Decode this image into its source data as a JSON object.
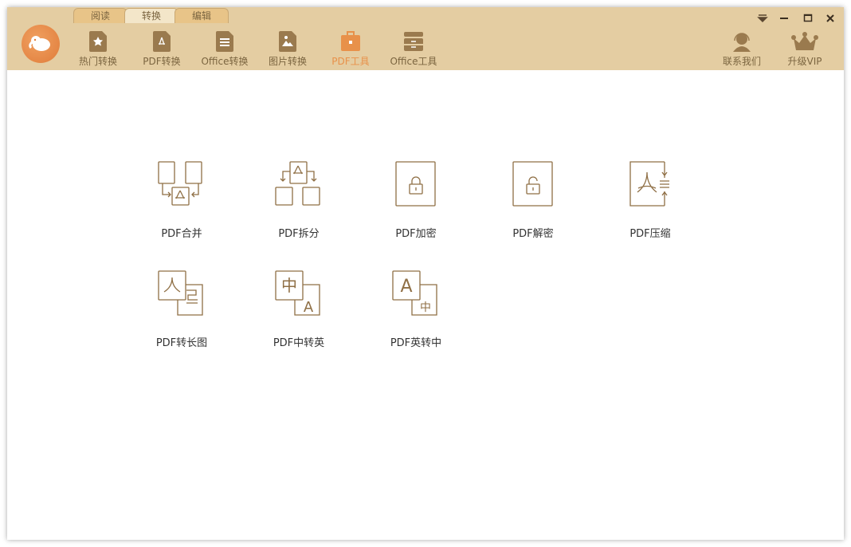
{
  "tabs": [
    {
      "label": "阅读"
    },
    {
      "label": "转换"
    },
    {
      "label": "编辑"
    }
  ],
  "active_tab": "转换",
  "nav": [
    {
      "label": "热门转换"
    },
    {
      "label": "PDF转换"
    },
    {
      "label": "Office转换"
    },
    {
      "label": "图片转换"
    },
    {
      "label": "PDF工具"
    },
    {
      "label": "Office工具"
    }
  ],
  "active_nav": "PDF工具",
  "right": {
    "contact": "联系我们",
    "vip": "升级VIP"
  },
  "tools": [
    {
      "label": "PDF合并"
    },
    {
      "label": "PDF拆分"
    },
    {
      "label": "PDF加密"
    },
    {
      "label": "PDF解密"
    },
    {
      "label": "PDF压缩"
    },
    {
      "label": "PDF转长图"
    },
    {
      "label": "PDF中转英"
    },
    {
      "label": "PDF英转中"
    }
  ],
  "glyphs": {
    "zh": "中",
    "en": "A"
  },
  "colors": {
    "header": "#e4cda2",
    "icon": "#9a7a4e",
    "accent": "#e8914a"
  }
}
